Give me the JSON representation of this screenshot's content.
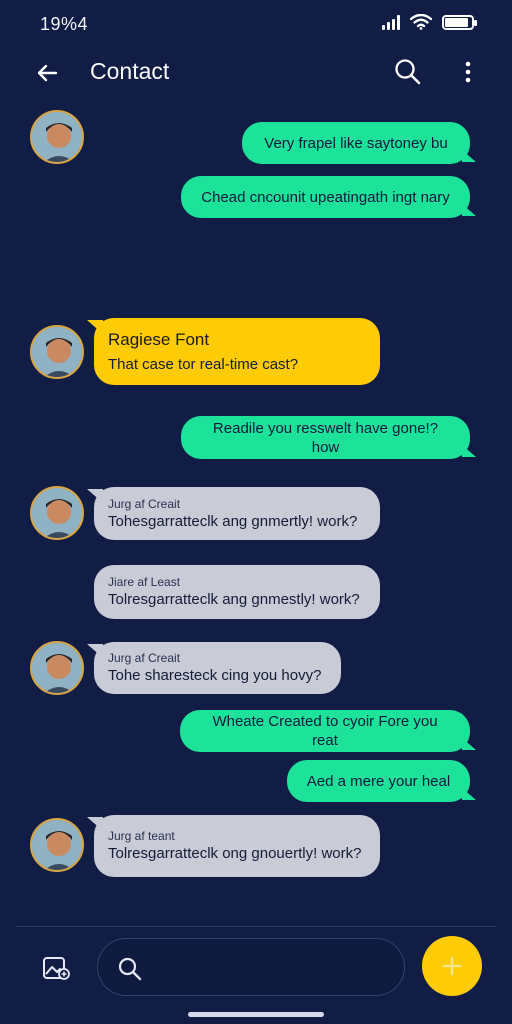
{
  "status_bar": {
    "time": "19%4"
  },
  "header": {
    "title": "Contact"
  },
  "messages": [
    {
      "type": "sent",
      "text": "Very frapel like saytoney bu"
    },
    {
      "type": "sent",
      "text": "Chead cncounit upeatingath ingt nary"
    },
    {
      "type": "received",
      "title": "Ragiese Font",
      "text": "That case tor real-time cast?"
    },
    {
      "type": "sent",
      "text": "Readile you resswelt have gone!? how"
    },
    {
      "type": "received",
      "name": "Jurg af Creait",
      "text": "Tohesgarratteclk ang gnmertly! work?"
    },
    {
      "type": "received",
      "name": "Jiare af Least",
      "text": "Tolresgarratteclk ang gnmestly! work?"
    },
    {
      "type": "received",
      "name": "Jurg af Creait",
      "text": "Tohe sharesteck cing you hovy?"
    },
    {
      "type": "sent",
      "text": "Wheate Created to cyoir Fore you reat"
    },
    {
      "type": "sent",
      "text": "Aed a mere your heal"
    },
    {
      "type": "received",
      "name": "Jurg af teant",
      "text": "Tolresgarratteclk ong gnouertly! work?"
    }
  ],
  "composer": {
    "search_placeholder": ""
  },
  "colors": {
    "background": "#111d45",
    "sent_bubble": "#1de29a",
    "received_bubble": "#c9cbd6",
    "highlight_bubble": "#ffcb05",
    "fab": "#ffcb05"
  },
  "icons": {
    "back": "back-arrow-icon",
    "search": "search-icon",
    "more": "more-vertical-icon",
    "attach": "image-attach-icon",
    "fab": "plus-icon"
  }
}
